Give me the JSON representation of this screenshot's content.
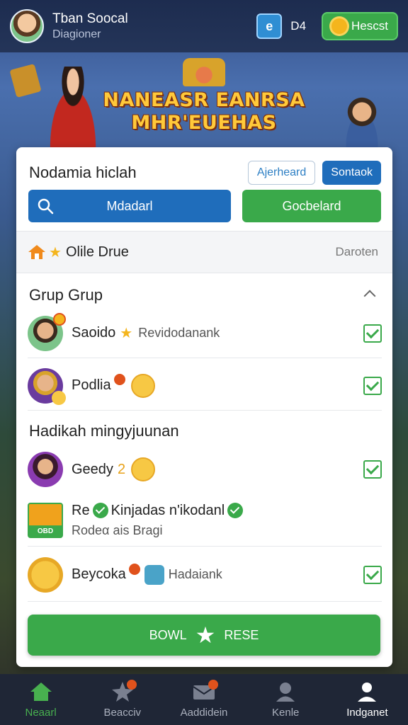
{
  "topbar": {
    "name": "Tban Soocal",
    "subtitle": "Diagioner",
    "badge_icon_text": "e",
    "badge_count": "D4",
    "button_label": "Hescst"
  },
  "banner": {
    "title_line1": "NANEASR EANRSA",
    "title_line2": "MHR'EUEHAS"
  },
  "card": {
    "title": "Nodamia hiclah",
    "outline_pill": "Ajerheard",
    "solid_pill": "Sontaok",
    "blue_button": "Mdadarl",
    "green_button": "Gocbelard",
    "filter_label": "Olile Drue",
    "filter_right": "Daroten",
    "section1_title": "Grup Grup",
    "section2_title": "Hadikah mingyjuunan",
    "rows": [
      {
        "name": "Saoido",
        "desc": "Revidodanank"
      },
      {
        "name": "Podlia"
      },
      {
        "name": "Geedy",
        "extra": "2"
      },
      {
        "name": "Re",
        "name_tail": "Kinjadas n'ikodanl",
        "desc": "Rodeα ais Bragi",
        "tile_text": "OBD"
      },
      {
        "name": "Beycoka",
        "desc": "Hadaiank"
      }
    ],
    "cta_left": "BOWL",
    "cta_right": "RESE"
  },
  "bottomnav": {
    "items": [
      {
        "label": "Neaarl",
        "icon": "home-icon",
        "active": true
      },
      {
        "label": "Beacciv",
        "icon": "star-icon"
      },
      {
        "label": "Aaddidein",
        "icon": "mail-icon"
      },
      {
        "label": "Kenle",
        "icon": "person-icon"
      },
      {
        "label": "Indganet",
        "icon": "profile-icon"
      }
    ]
  },
  "colors": {
    "green": "#3aa94a",
    "blue": "#1f6dbb",
    "navbar": "#1f2636",
    "accent_orange": "#e0521c"
  }
}
